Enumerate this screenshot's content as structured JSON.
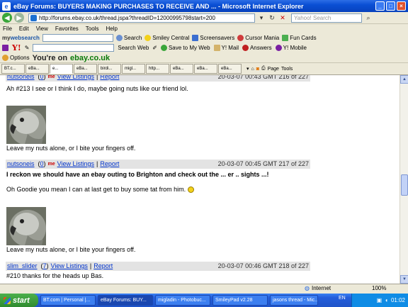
{
  "window": {
    "title": "eBay Forums: BUYERS MAKING PURCHASES TO RECEIVE AND ... - Microsoft Internet Explorer",
    "buttons": [
      "_",
      "□",
      "×"
    ]
  },
  "address": {
    "url": "http://forums.ebay.co.uk/thread.jspa?threadID=12000995798start=200",
    "search_placeholder": "Yahoo! Search"
  },
  "menu": [
    "File",
    "Edit",
    "View",
    "Favorites",
    "Tools",
    "Help"
  ],
  "mywebsearch": {
    "logo_prefix": "my",
    "logo_main": "websearch",
    "search_label": "Search",
    "items": [
      "Smiley Central",
      "Screensavers",
      "Cursor Mania",
      "Fun Cards"
    ]
  },
  "yahoo": {
    "logo": "Y!",
    "search_web": "Search Web",
    "items": [
      "Save to My Web",
      "Y! Mail",
      "Answers",
      "Y! Mobile"
    ]
  },
  "ebaybar": {
    "options": "Options",
    "youre_on": "You're on",
    "site": "ebay.co.uk"
  },
  "tabs": [
    "BT.c...",
    "eBa...",
    "e...",
    "eBa...",
    "birdi...",
    "migl...",
    "http...",
    "eBa...",
    "eBa...",
    "eBa..."
  ],
  "tab_tools": {
    "page": "Page",
    "tools": "Tools"
  },
  "posts": [
    {
      "user": "nutsoneis",
      "feedback": "0",
      "view_listings": "View Listings",
      "report": "Report",
      "date": "20-03-07 00:43 GMT 216 of 227",
      "text": "Ah #213 I see or I think I do, maybe going nuts like our friend lol.",
      "signature": "Leave my nuts alone, or I bite your fingers off."
    },
    {
      "user": "nutsoneis",
      "feedback": "0",
      "view_listings": "View Listings",
      "report": "Report",
      "date": "20-03-07 00:45 GMT 217 of 227",
      "text_bold": "I reckon we should have an ebay outing to Brighton and check out the ... er .. sights ...!",
      "text": "Oh Goodie you mean I can at last get to buy some tat from him.",
      "signature": "Leave my nuts alone, or I bite your fingers off."
    },
    {
      "user": "slim_slider",
      "feedback": "7",
      "view_listings": "View Listings",
      "report": "Report",
      "date": "20-03-07 00:46 GMT 218 of 227",
      "text": "#210 thanks for the heads up Bas."
    }
  ],
  "me_icon": "me",
  "status": {
    "zone": "Internet",
    "zoom": "100%"
  },
  "taskbar": {
    "start": "start",
    "tasks": [
      "BT.com | Personal |...",
      "eBay Forums: BUY...",
      "migladin - Photobuc...",
      "SmileyPad v2.28",
      "jasons thread - Mic..."
    ],
    "lang": "EN",
    "clock": "01:02"
  }
}
